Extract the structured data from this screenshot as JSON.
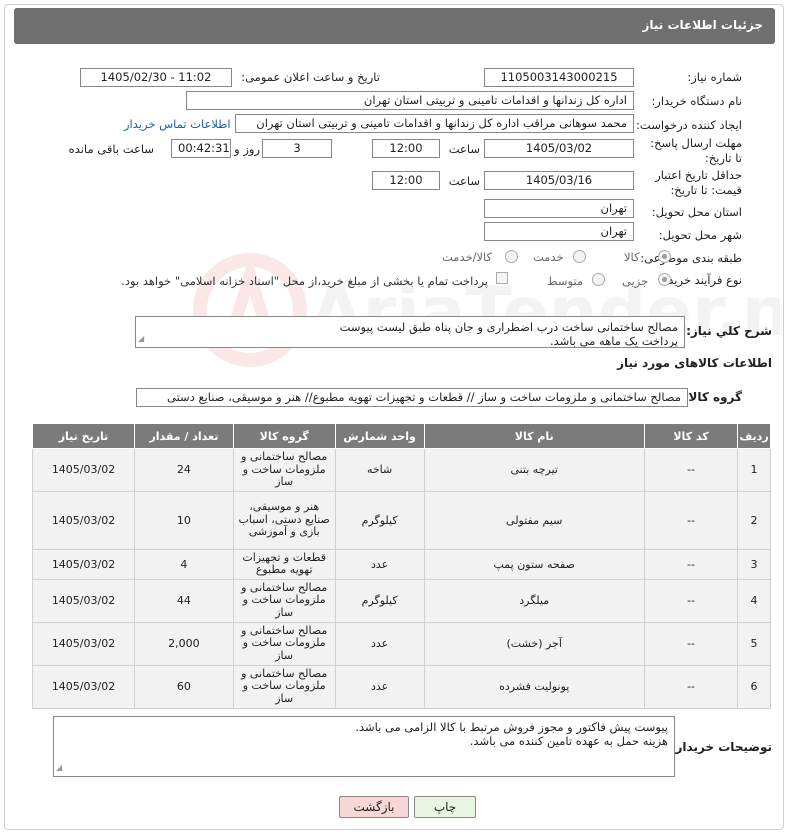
{
  "header": {
    "title": "جزئیات اطلاعات نیاز"
  },
  "form": {
    "need_number_label": "شماره نیاز:",
    "need_number": "1105003143000215",
    "announce_label": "تاریخ و ساعت اعلان عمومی:",
    "announce_value": "1405/02/30 - 11:02",
    "buyer_org_label": "نام دستگاه خریدار:",
    "buyer_org": "اداره کل زندانها و اقدامات تامینی و تربیتی استان تهران",
    "creator_label": "ایجاد کننده درخواست:",
    "creator": "محمد سوهانی مراقب  اداره کل زندانها و اقدامات تامینی و تربیتی استان تهران",
    "contact_link": "اطلاعات تماس خریدار",
    "deadline_label": "مهلت ارسال پاسخ: تا تاریخ:",
    "deadline_date": "1405/03/02",
    "time_label": "ساعت",
    "deadline_time": "12:00",
    "days_value": "3",
    "days_label": "روز و",
    "remaining_time": "00:42:31",
    "remaining_label": "ساعت باقی مانده",
    "validity_label": "حداقل تاریخ اعتبار قیمت: تا تاریخ:",
    "validity_date": "1405/03/16",
    "validity_time": "12:00",
    "province_label": "استان محل تحویل:",
    "province": "تهران",
    "city_label": "شهر محل تحویل:",
    "city": "تهران",
    "category_label": "طبقه بندی موضوعی:",
    "category_options": [
      "کالا",
      "خدمت",
      "کالا/خدمت"
    ],
    "process_label": "نوع فرآیند خرید :",
    "process_options": [
      "جزیی",
      "متوسط"
    ],
    "payment_note": "پرداخت تمام یا بخشی از مبلغ خرید،از محل \"اسناد خزانه اسلامی\" خواهد بود.",
    "description_label": "شرح کلي نياز:",
    "description_line1": "مصالح ساختمانی ساخت درب اضطراری و جان پناه طبق لیست پیوست",
    "description_line2": "پرداخت یک ماهه می باشد.",
    "items_section_title": "اطلاعات کالاهای مورد نیاز",
    "goods_group_label": "گروه کالا:",
    "goods_group": "مصالح ساختمانی و ملزومات ساخت و ساز //  قطعات و تجهیزات تهویه مطبوع// هنر و موسیقی، صنایع دستی",
    "buyer_notes_label": "توضیحات خریدار:",
    "buyer_notes_line1": "پیوست پیش فاکتور و مجوز فروش مرتبط با کالا الزامی می باشد.",
    "buyer_notes_line2": "هزینه حمل به عهده تامین کننده می باشد."
  },
  "table": {
    "headers": [
      "ردیف",
      "کد کالا",
      "نام کالا",
      "واحد شمارش",
      "گروه کالا",
      "تعداد / مقدار",
      "تاریخ نیاز"
    ],
    "rows": [
      {
        "idx": "1",
        "code": "--",
        "name": "تیرچه بتنی",
        "unit": "شاخه",
        "group": "مصالح ساختمانی و ملزومات ساخت و ساز",
        "qty": "24",
        "date": "1405/03/02"
      },
      {
        "idx": "2",
        "code": "--",
        "name": "سیم مفتولی",
        "unit": "کیلوگرم",
        "group": "هنر و موسیقی، صنایع دستی، اسباب بازی و آموزشی",
        "qty": "10",
        "date": "1405/03/02"
      },
      {
        "idx": "3",
        "code": "--",
        "name": "صفحه ستون پمپ",
        "unit": "عدد",
        "group": "قطعات و تجهیزات تهویه مطبوع",
        "qty": "4",
        "date": "1405/03/02"
      },
      {
        "idx": "4",
        "code": "--",
        "name": "میلگرد",
        "unit": "کیلوگرم",
        "group": "مصالح ساختمانی و ملزومات ساخت و ساز",
        "qty": "44",
        "date": "1405/03/02"
      },
      {
        "idx": "5",
        "code": "--",
        "name": "آجر (خشت)",
        "unit": "عدد",
        "group": "مصالح ساختمانی و ملزومات ساخت و ساز",
        "qty": "2,000",
        "date": "1405/03/02"
      },
      {
        "idx": "6",
        "code": "--",
        "name": "پونولیت فشرده",
        "unit": "عدد",
        "group": "مصالح ساختمانی و ملزومات ساخت و ساز",
        "qty": "60",
        "date": "1405/03/02"
      }
    ]
  },
  "buttons": {
    "print": "چاپ",
    "back": "بازگشت"
  },
  "watermark": {
    "text": "AriaTender.neT"
  },
  "colors": {
    "header_bg": "#6f6f6f",
    "table_header_bg": "#7b7b7b",
    "back_button_bg": "#f8d7d7",
    "print_button_bg": "#e8f5e0"
  }
}
